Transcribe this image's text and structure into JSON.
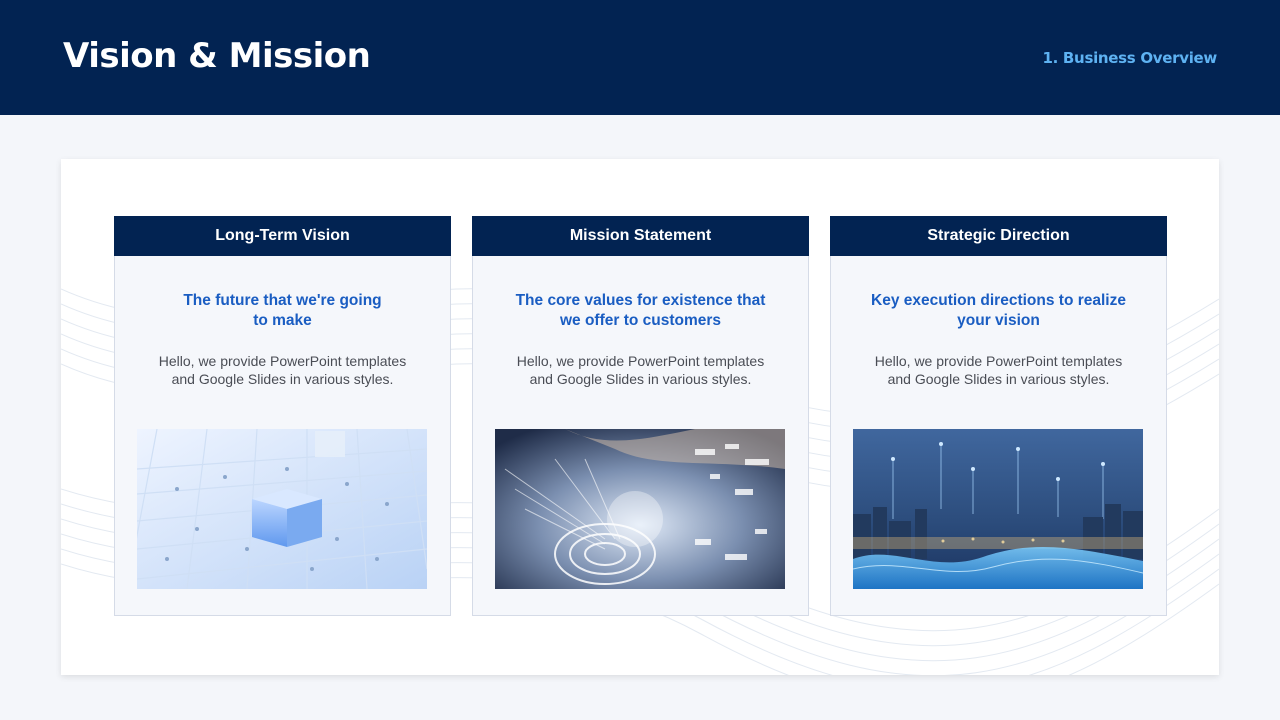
{
  "header": {
    "title": "Vision & Mission",
    "section": "1. Business Overview"
  },
  "colors": {
    "header_bg": "#022352",
    "accent_text": "#5eb2f2",
    "subtitle_blue": "#1a5dc2",
    "card_bg": "#f5f7fb"
  },
  "cards": [
    {
      "title": "Long-Term Vision",
      "subtitle": [
        "The future that we're going",
        "to make"
      ],
      "body": [
        "Hello, we provide PowerPoint templates",
        "and Google Slides in various styles."
      ],
      "image": "isometric-cube-grid-image"
    },
    {
      "title": "Mission Statement",
      "subtitle": [
        "The core values for existence that",
        "we offer to  customers"
      ],
      "body": [
        "Hello, we provide PowerPoint templates",
        "and Google Slides in various styles."
      ],
      "image": "digital-hand-tech-image"
    },
    {
      "title": "Strategic Direction",
      "subtitle": [
        "Key execution directions to realize",
        "your vision"
      ],
      "body": [
        "Hello, we provide PowerPoint templates",
        "and Google Slides in various styles."
      ],
      "image": "night-city-data-image"
    }
  ]
}
